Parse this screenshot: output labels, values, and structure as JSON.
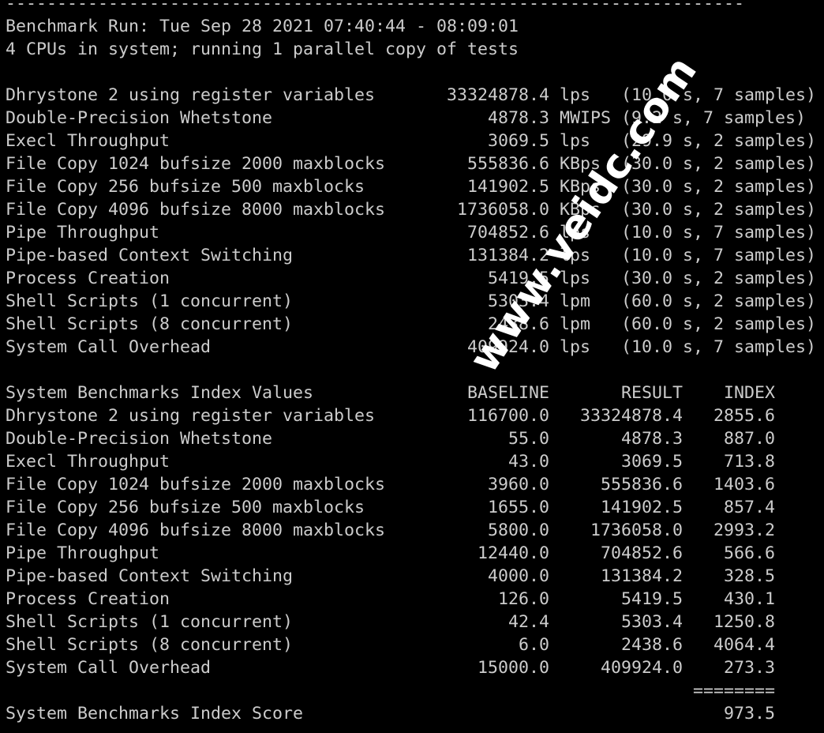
{
  "separator_top": "------------------------------------------------------------------------",
  "run_line": "Benchmark Run: Tue Sep 28 2021 07:40:44 - 08:09:01",
  "cpu_line": "4 CPUs in system; running 1 parallel copy of tests",
  "results": [
    {
      "name": "Dhrystone 2 using register variables",
      "value": "33324878.4",
      "unit": "lps",
      "detail": "(10.0 s, 7 samples)"
    },
    {
      "name": "Double-Precision Whetstone",
      "value": "4878.3",
      "unit": "MWIPS",
      "detail": "(9.2 s, 7 samples)"
    },
    {
      "name": "Execl Throughput",
      "value": "3069.5",
      "unit": "lps",
      "detail": "(29.9 s, 2 samples)"
    },
    {
      "name": "File Copy 1024 bufsize 2000 maxblocks",
      "value": "555836.6",
      "unit": "KBps",
      "detail": "(30.0 s, 2 samples)"
    },
    {
      "name": "File Copy 256 bufsize 500 maxblocks",
      "value": "141902.5",
      "unit": "KBps",
      "detail": "(30.0 s, 2 samples)"
    },
    {
      "name": "File Copy 4096 bufsize 8000 maxblocks",
      "value": "1736058.0",
      "unit": "KBps",
      "detail": "(30.0 s, 2 samples)"
    },
    {
      "name": "Pipe Throughput",
      "value": "704852.6",
      "unit": "lps",
      "detail": "(10.0 s, 7 samples)"
    },
    {
      "name": "Pipe-based Context Switching",
      "value": "131384.2",
      "unit": "lps",
      "detail": "(10.0 s, 7 samples)"
    },
    {
      "name": "Process Creation",
      "value": "5419.5",
      "unit": "lps",
      "detail": "(30.0 s, 2 samples)"
    },
    {
      "name": "Shell Scripts (1 concurrent)",
      "value": "5303.4",
      "unit": "lpm",
      "detail": "(60.0 s, 2 samples)"
    },
    {
      "name": "Shell Scripts (8 concurrent)",
      "value": "2438.6",
      "unit": "lpm",
      "detail": "(60.0 s, 2 samples)"
    },
    {
      "name": "System Call Overhead",
      "value": "409924.0",
      "unit": "lps",
      "detail": "(10.0 s, 7 samples)"
    }
  ],
  "index_header": {
    "title": "System Benchmarks Index Values",
    "baseline": "BASELINE",
    "result": "RESULT",
    "index": "INDEX"
  },
  "index_rows": [
    {
      "name": "Dhrystone 2 using register variables",
      "baseline": "116700.0",
      "result": "33324878.4",
      "index": "2855.6"
    },
    {
      "name": "Double-Precision Whetstone",
      "baseline": "55.0",
      "result": "4878.3",
      "index": "887.0"
    },
    {
      "name": "Execl Throughput",
      "baseline": "43.0",
      "result": "3069.5",
      "index": "713.8"
    },
    {
      "name": "File Copy 1024 bufsize 2000 maxblocks",
      "baseline": "3960.0",
      "result": "555836.6",
      "index": "1403.6"
    },
    {
      "name": "File Copy 256 bufsize 500 maxblocks",
      "baseline": "1655.0",
      "result": "141902.5",
      "index": "857.4"
    },
    {
      "name": "File Copy 4096 bufsize 8000 maxblocks",
      "baseline": "5800.0",
      "result": "1736058.0",
      "index": "2993.2"
    },
    {
      "name": "Pipe Throughput",
      "baseline": "12440.0",
      "result": "704852.6",
      "index": "566.6"
    },
    {
      "name": "Pipe-based Context Switching",
      "baseline": "4000.0",
      "result": "131384.2",
      "index": "328.5"
    },
    {
      "name": "Process Creation",
      "baseline": "126.0",
      "result": "5419.5",
      "index": "430.1"
    },
    {
      "name": "Shell Scripts (1 concurrent)",
      "baseline": "42.4",
      "result": "5303.4",
      "index": "1250.8"
    },
    {
      "name": "Shell Scripts (8 concurrent)",
      "baseline": "6.0",
      "result": "2438.6",
      "index": "4064.4"
    },
    {
      "name": "System Call Overhead",
      "baseline": "15000.0",
      "result": "409924.0",
      "index": "273.3"
    }
  ],
  "score_separator": "========",
  "score_label": "System Benchmarks Index Score",
  "score": "973.5",
  "watermark": "www.veidc.com"
}
